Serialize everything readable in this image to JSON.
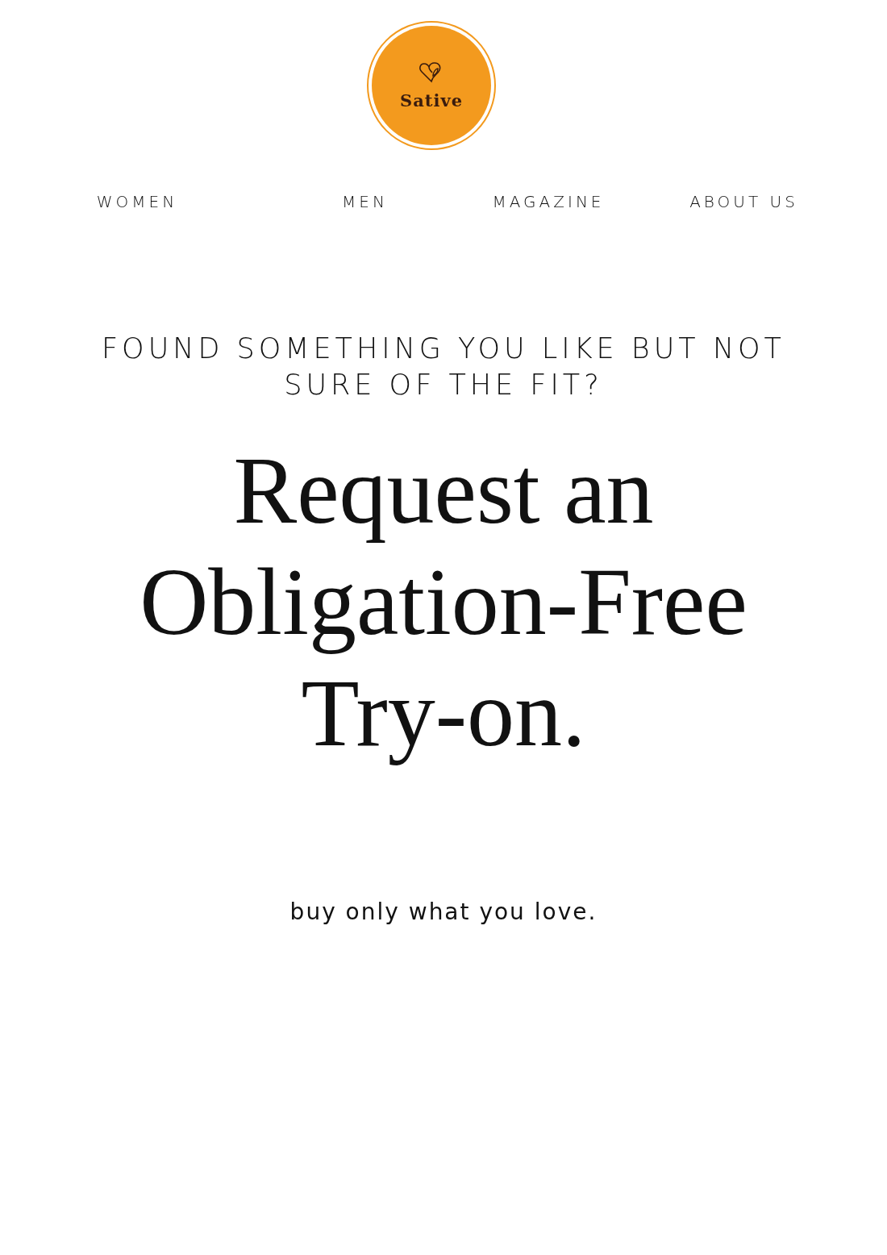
{
  "logo": {
    "name": "Sative"
  },
  "nav": [
    {
      "label": "WOMEN"
    },
    {
      "label": "MEN"
    },
    {
      "label": "MAGAZINE"
    },
    {
      "label": "ABOUT US"
    }
  ],
  "hero": {
    "eyebrow": "FOUND SOMETHING YOU LIKE BUT NOT SURE OF THE FIT?",
    "headline": "Request an Obligation-Free Try-on.",
    "tagline": "buy only what you love."
  }
}
